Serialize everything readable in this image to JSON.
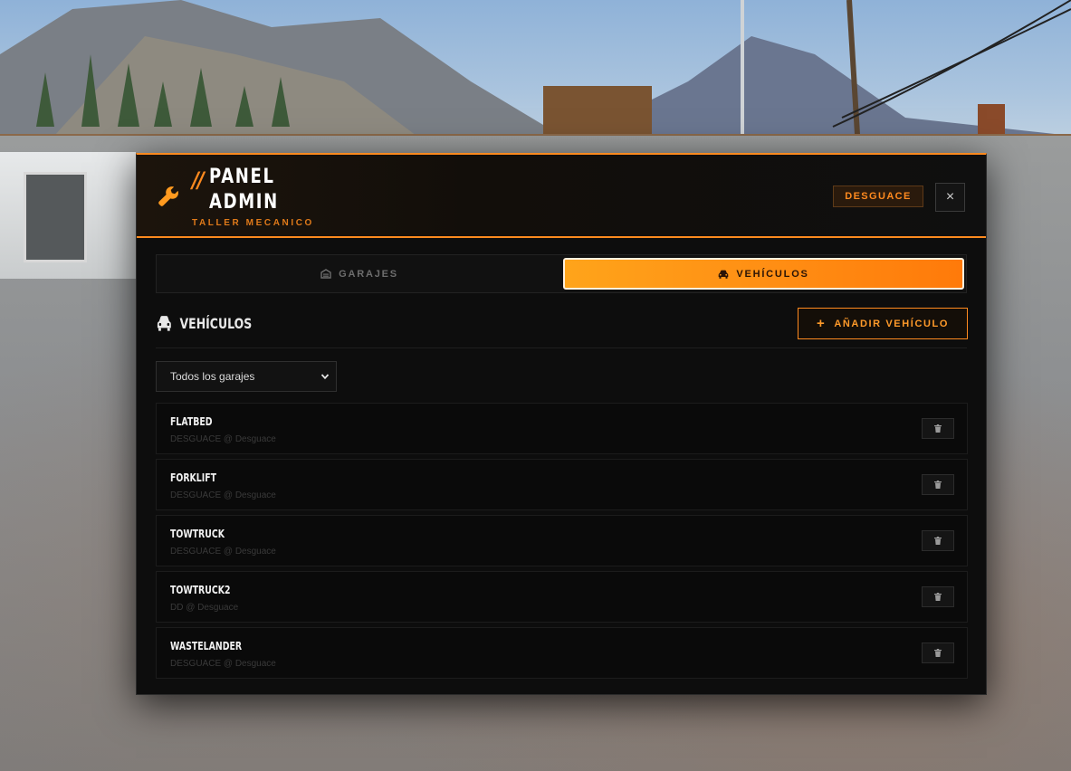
{
  "header": {
    "slash": "//",
    "title_line1": "PANEL",
    "title_line2": "ADMIN",
    "subtitle": "TALLER MECANICO",
    "badge": "DESGUACE",
    "close_symbol": "×",
    "icons": {
      "logo": "wrench-icon",
      "close": "close-icon"
    }
  },
  "tabs": [
    {
      "label": "GARAJES",
      "icon": "garage-icon",
      "active": false
    },
    {
      "label": "VEHÍCULOS",
      "icon": "car-icon",
      "active": true
    }
  ],
  "section": {
    "title": "VEHÍCULOS",
    "icon": "car-icon",
    "add_button": {
      "symbol": "+",
      "label": "AÑADIR VEHÍCULO"
    }
  },
  "filter": {
    "selected": "Todos los garajes",
    "icon": "chevron-down-icon"
  },
  "vehicles": [
    {
      "name": "FLATBED",
      "subtitle": "DESGUACE @ Desguace"
    },
    {
      "name": "FORKLIFT",
      "subtitle": "DESGUACE @ Desguace"
    },
    {
      "name": "TOWTRUCK",
      "subtitle": "DESGUACE @ Desguace"
    },
    {
      "name": "TOWTRUCK2",
      "subtitle": "DD @ Desguace"
    },
    {
      "name": "WASTELANDER",
      "subtitle": "DESGUACE @ Desguace"
    }
  ],
  "colors": {
    "accent": "#ff8a1f",
    "panel_bg": "#0d0d0d",
    "row_bg": "#0a0a0a",
    "active_tab_gradient_start": "#ffa41a",
    "active_tab_gradient_end": "#ff7a0a"
  }
}
